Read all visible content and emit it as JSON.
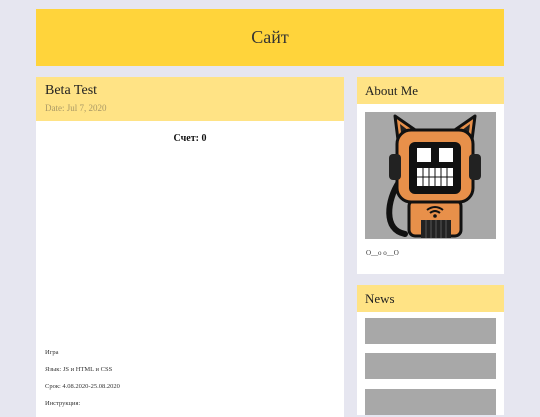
{
  "header": {
    "title": "Сайт"
  },
  "post": {
    "title": "Beta Test",
    "date": "Date: Jul 7, 2020",
    "score": "Счет: 0",
    "info": [
      "Игра",
      "Язык: JS и HTML и CSS",
      "Срок: 4.08.2020-25.08.2020",
      "Инструкция:"
    ]
  },
  "about": {
    "title": "About Me",
    "text": "O__o o__O",
    "avatar_icon": "robot-cat-icon"
  },
  "news": {
    "title": "News",
    "items": [
      "",
      "",
      ""
    ]
  },
  "colors": {
    "header_bg": "#ffd43b",
    "card_head_bg": "#ffe385",
    "page_bg": "#e6e6f0",
    "placeholder": "#a8a8a8",
    "robot_orange": "#e8904a"
  }
}
